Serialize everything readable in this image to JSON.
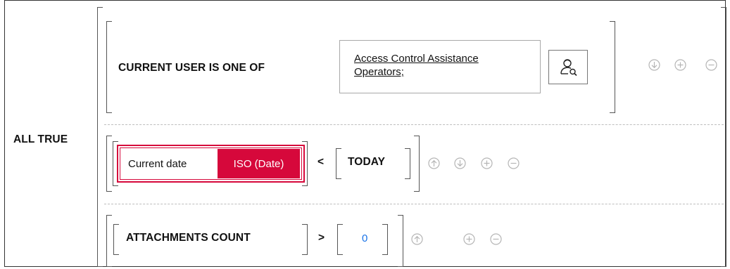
{
  "group": {
    "label": "ALL TRUE"
  },
  "rule1": {
    "field": "CURRENT USER IS ONE OF",
    "value_link": [
      "Access Control Assistance",
      "Operators;"
    ],
    "picker_icon": "user-search-icon",
    "controls": [
      "move-down-icon",
      "add-icon",
      "remove-icon"
    ]
  },
  "rule2": {
    "field_label": "Current date",
    "format_tag": "ISO (Date)",
    "operator": "<",
    "value": "TODAY",
    "controls": [
      "move-up-icon",
      "move-down-icon",
      "add-icon",
      "remove-icon"
    ]
  },
  "rule3": {
    "field": "ATTACHMENTS COUNT",
    "operator": ">",
    "value": "0",
    "controls": [
      "move-up-icon",
      "add-icon",
      "remove-icon"
    ]
  },
  "colors": {
    "error": "#d6083b",
    "link_value": "#1a73e8",
    "control_gray": "#b5b5b5"
  }
}
